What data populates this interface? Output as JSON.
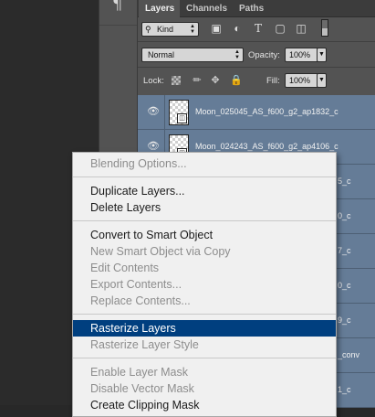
{
  "tool_column": {
    "icon": "paragraph-icon"
  },
  "panel": {
    "tabs": [
      {
        "label": "Layers",
        "active": true
      },
      {
        "label": "Channels",
        "active": false
      },
      {
        "label": "Paths",
        "active": false
      }
    ],
    "filter": {
      "kind_label": "Kind",
      "icons": [
        "pixel-filter-icon",
        "adjustment-filter-icon",
        "type-filter-icon",
        "shape-filter-icon",
        "smart-object-filter-icon"
      ]
    },
    "blend_mode": "Normal",
    "opacity_label": "Opacity:",
    "opacity_value": "100%",
    "lock_label": "Lock:",
    "fill_label": "Fill:",
    "fill_value": "100%"
  },
  "layers": [
    {
      "name": "Moon_025045_AS_f600_g2_ap1832_c",
      "tail": ""
    },
    {
      "name": "Moon_024243_AS_f600_g2_ap4106_c",
      "tail": ""
    },
    {
      "name": "",
      "tail": "5_c"
    },
    {
      "name": "",
      "tail": "0_c"
    },
    {
      "name": "",
      "tail": "7_c"
    },
    {
      "name": "",
      "tail": "0_c"
    },
    {
      "name": "",
      "tail": "9_c"
    },
    {
      "name": "",
      "tail": "_conv"
    },
    {
      "name": "",
      "tail": "1_c"
    }
  ],
  "context_menu": {
    "items": [
      {
        "label": "Blending Options...",
        "disabled": true
      },
      {
        "label": "Duplicate Layers...",
        "disabled": false
      },
      {
        "label": "Delete Layers",
        "disabled": false
      },
      {
        "label": "Convert to Smart Object",
        "disabled": false
      },
      {
        "label": "New Smart Object via Copy",
        "disabled": true
      },
      {
        "label": "Edit Contents",
        "disabled": true
      },
      {
        "label": "Export Contents...",
        "disabled": true
      },
      {
        "label": "Replace Contents...",
        "disabled": true
      },
      {
        "label": "Rasterize Layers",
        "disabled": false,
        "highlighted": true
      },
      {
        "label": "Rasterize Layer Style",
        "disabled": true
      },
      {
        "label": "Enable Layer Mask",
        "disabled": true
      },
      {
        "label": "Disable Vector Mask",
        "disabled": true
      },
      {
        "label": "Create Clipping Mask",
        "disabled": false
      }
    ]
  },
  "colors": {
    "selection_highlight": "#003f7f",
    "selected_layer_row": "#657c97",
    "panel_bg": "#535353"
  }
}
